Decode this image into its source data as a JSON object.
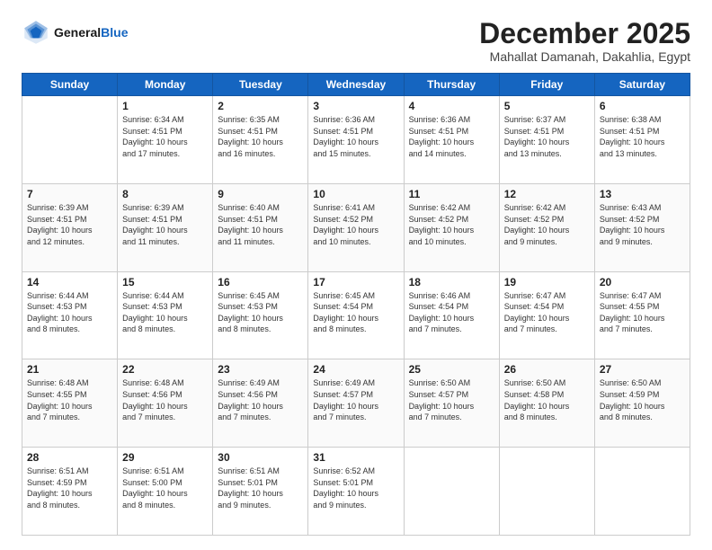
{
  "logo": {
    "line1": "General",
    "line2": "Blue"
  },
  "header": {
    "month": "December 2025",
    "location": "Mahallat Damanah, Dakahlia, Egypt"
  },
  "days_of_week": [
    "Sunday",
    "Monday",
    "Tuesday",
    "Wednesday",
    "Thursday",
    "Friday",
    "Saturday"
  ],
  "weeks": [
    [
      {
        "day": "",
        "info": ""
      },
      {
        "day": "1",
        "info": "Sunrise: 6:34 AM\nSunset: 4:51 PM\nDaylight: 10 hours\nand 17 minutes."
      },
      {
        "day": "2",
        "info": "Sunrise: 6:35 AM\nSunset: 4:51 PM\nDaylight: 10 hours\nand 16 minutes."
      },
      {
        "day": "3",
        "info": "Sunrise: 6:36 AM\nSunset: 4:51 PM\nDaylight: 10 hours\nand 15 minutes."
      },
      {
        "day": "4",
        "info": "Sunrise: 6:36 AM\nSunset: 4:51 PM\nDaylight: 10 hours\nand 14 minutes."
      },
      {
        "day": "5",
        "info": "Sunrise: 6:37 AM\nSunset: 4:51 PM\nDaylight: 10 hours\nand 13 minutes."
      },
      {
        "day": "6",
        "info": "Sunrise: 6:38 AM\nSunset: 4:51 PM\nDaylight: 10 hours\nand 13 minutes."
      }
    ],
    [
      {
        "day": "7",
        "info": "Sunrise: 6:39 AM\nSunset: 4:51 PM\nDaylight: 10 hours\nand 12 minutes."
      },
      {
        "day": "8",
        "info": "Sunrise: 6:39 AM\nSunset: 4:51 PM\nDaylight: 10 hours\nand 11 minutes."
      },
      {
        "day": "9",
        "info": "Sunrise: 6:40 AM\nSunset: 4:51 PM\nDaylight: 10 hours\nand 11 minutes."
      },
      {
        "day": "10",
        "info": "Sunrise: 6:41 AM\nSunset: 4:52 PM\nDaylight: 10 hours\nand 10 minutes."
      },
      {
        "day": "11",
        "info": "Sunrise: 6:42 AM\nSunset: 4:52 PM\nDaylight: 10 hours\nand 10 minutes."
      },
      {
        "day": "12",
        "info": "Sunrise: 6:42 AM\nSunset: 4:52 PM\nDaylight: 10 hours\nand 9 minutes."
      },
      {
        "day": "13",
        "info": "Sunrise: 6:43 AM\nSunset: 4:52 PM\nDaylight: 10 hours\nand 9 minutes."
      }
    ],
    [
      {
        "day": "14",
        "info": "Sunrise: 6:44 AM\nSunset: 4:53 PM\nDaylight: 10 hours\nand 8 minutes."
      },
      {
        "day": "15",
        "info": "Sunrise: 6:44 AM\nSunset: 4:53 PM\nDaylight: 10 hours\nand 8 minutes."
      },
      {
        "day": "16",
        "info": "Sunrise: 6:45 AM\nSunset: 4:53 PM\nDaylight: 10 hours\nand 8 minutes."
      },
      {
        "day": "17",
        "info": "Sunrise: 6:45 AM\nSunset: 4:54 PM\nDaylight: 10 hours\nand 8 minutes."
      },
      {
        "day": "18",
        "info": "Sunrise: 6:46 AM\nSunset: 4:54 PM\nDaylight: 10 hours\nand 7 minutes."
      },
      {
        "day": "19",
        "info": "Sunrise: 6:47 AM\nSunset: 4:54 PM\nDaylight: 10 hours\nand 7 minutes."
      },
      {
        "day": "20",
        "info": "Sunrise: 6:47 AM\nSunset: 4:55 PM\nDaylight: 10 hours\nand 7 minutes."
      }
    ],
    [
      {
        "day": "21",
        "info": "Sunrise: 6:48 AM\nSunset: 4:55 PM\nDaylight: 10 hours\nand 7 minutes."
      },
      {
        "day": "22",
        "info": "Sunrise: 6:48 AM\nSunset: 4:56 PM\nDaylight: 10 hours\nand 7 minutes."
      },
      {
        "day": "23",
        "info": "Sunrise: 6:49 AM\nSunset: 4:56 PM\nDaylight: 10 hours\nand 7 minutes."
      },
      {
        "day": "24",
        "info": "Sunrise: 6:49 AM\nSunset: 4:57 PM\nDaylight: 10 hours\nand 7 minutes."
      },
      {
        "day": "25",
        "info": "Sunrise: 6:50 AM\nSunset: 4:57 PM\nDaylight: 10 hours\nand 7 minutes."
      },
      {
        "day": "26",
        "info": "Sunrise: 6:50 AM\nSunset: 4:58 PM\nDaylight: 10 hours\nand 8 minutes."
      },
      {
        "day": "27",
        "info": "Sunrise: 6:50 AM\nSunset: 4:59 PM\nDaylight: 10 hours\nand 8 minutes."
      }
    ],
    [
      {
        "day": "28",
        "info": "Sunrise: 6:51 AM\nSunset: 4:59 PM\nDaylight: 10 hours\nand 8 minutes."
      },
      {
        "day": "29",
        "info": "Sunrise: 6:51 AM\nSunset: 5:00 PM\nDaylight: 10 hours\nand 8 minutes."
      },
      {
        "day": "30",
        "info": "Sunrise: 6:51 AM\nSunset: 5:01 PM\nDaylight: 10 hours\nand 9 minutes."
      },
      {
        "day": "31",
        "info": "Sunrise: 6:52 AM\nSunset: 5:01 PM\nDaylight: 10 hours\nand 9 minutes."
      },
      {
        "day": "",
        "info": ""
      },
      {
        "day": "",
        "info": ""
      },
      {
        "day": "",
        "info": ""
      }
    ]
  ]
}
